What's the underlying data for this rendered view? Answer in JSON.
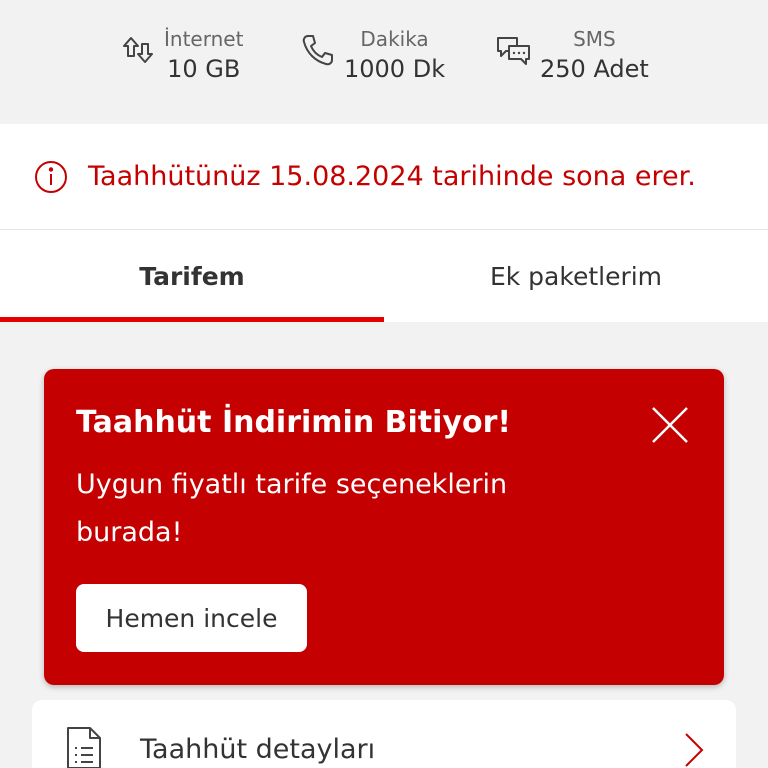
{
  "summary": {
    "internet": {
      "label": "İnternet",
      "value": "10 GB",
      "icon": "data-transfer-icon"
    },
    "dakika": {
      "label": "Dakika",
      "value": "1000 Dk",
      "icon": "phone-icon"
    },
    "sms": {
      "label": "SMS",
      "value": "250 Adet",
      "icon": "chat-bubbles-icon"
    }
  },
  "notice": {
    "text": "Taahhütünüz 15.08.2024 tarihinde sona erer.",
    "icon": "info-icon"
  },
  "tabs": [
    {
      "label": "Tarifem",
      "active": true
    },
    {
      "label": "Ek paketlerim",
      "active": false
    }
  ],
  "promo": {
    "title": "Taahhüt İndirimin Bitiyor!",
    "text": "Uygun fiyatlı tarife seçeneklerin burada!",
    "button": "Hemen incele",
    "icon": "close-icon"
  },
  "detail": {
    "label": "Taahhüt detayları",
    "icon": "document-icon"
  },
  "colors": {
    "brand_red": "#e60000",
    "promo_red": "#c40000",
    "background": "#f2f2f2"
  }
}
